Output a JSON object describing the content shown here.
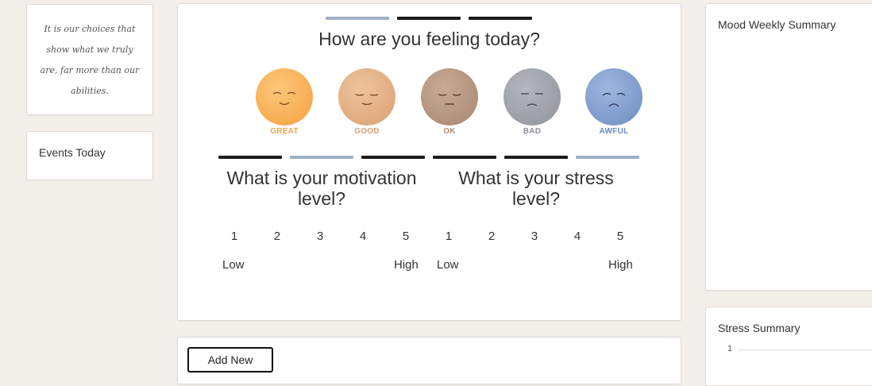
{
  "quote": {
    "text": "It is our choices that show what we truly are, far more than our abilities."
  },
  "events": {
    "title": "Events Today"
  },
  "mood_prompt": {
    "title": "How are you feeling today?"
  },
  "moods": [
    {
      "label": "GREAT",
      "color": "#f0a54a",
      "face_color": "#fbb65a"
    },
    {
      "label": "GOOD",
      "color": "#d9a071",
      "face_color": "#e3b089"
    },
    {
      "label": "OK",
      "color": "#b08b70",
      "face_color": "#b89a82"
    },
    {
      "label": "BAD",
      "color": "#8e929c",
      "face_color": "#9fa2aa"
    },
    {
      "label": "AWFUL",
      "color": "#6d8cc0",
      "face_color": "#7d9bd0"
    }
  ],
  "motivation": {
    "title_line1": "What is your motivation",
    "title_line2": "level?",
    "scale": [
      "1",
      "2",
      "3",
      "4",
      "5"
    ],
    "low_label": "Low",
    "high_label": "High"
  },
  "stress": {
    "title_line1": "What is your stress",
    "title_line2": "level?",
    "scale": [
      "1",
      "2",
      "3",
      "4",
      "5"
    ],
    "low_label": "Low",
    "high_label": "High"
  },
  "actions": {
    "add_new_label": "Add New"
  },
  "mood_summary": {
    "title": "Mood Weekly Summary"
  },
  "stress_summary": {
    "title": "Stress Summary",
    "y_tick": "1"
  }
}
